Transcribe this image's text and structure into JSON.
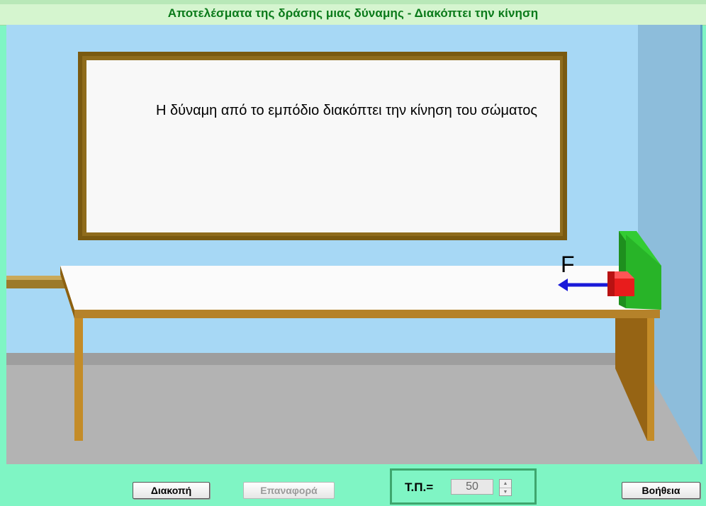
{
  "window": {
    "title": "Αποτελέσματα της δράσης μιας δύναμης -  Διακόπτει την  κίνηση"
  },
  "scene": {
    "board_text": "Η δύναμη από το εμπόδιο διακόπτει την κίνηση του σώματος",
    "force_label": "F"
  },
  "controls": {
    "stop_button": "Διακοπή",
    "reset_button": "Επαναφορά",
    "tp_label": "Τ.Π.=",
    "tp_value": "50",
    "help_button": "Βοήθεια"
  },
  "colors": {
    "background": "#7ff5c4",
    "title_text": "#0a7a1a",
    "wall": "#a7d8f5",
    "floor": "#b0b0b0",
    "table_wood": "#a5721e",
    "obstacle": "#2ab52a",
    "box": "#e81c1c",
    "force_arrow": "#1a1ad9"
  }
}
